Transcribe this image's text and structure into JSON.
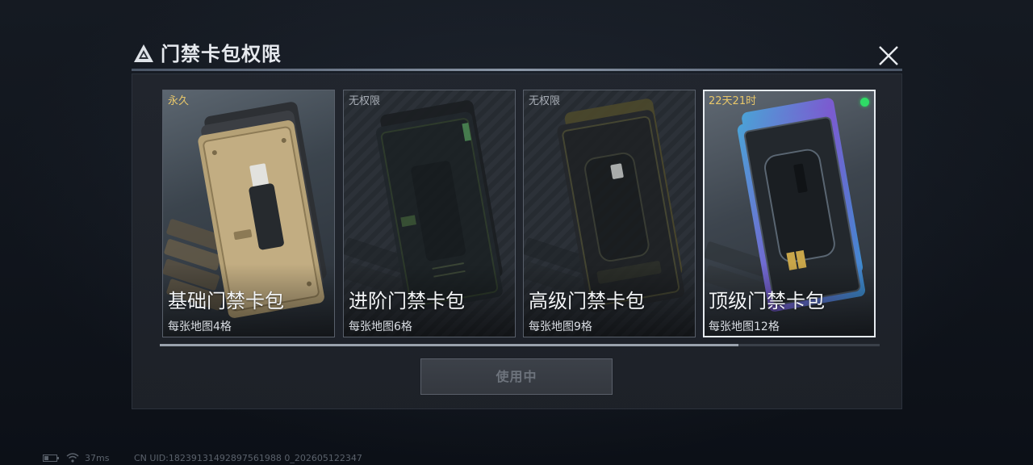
{
  "dialog": {
    "title": "门禁卡包权限",
    "use_button_label": "使用中"
  },
  "cards": [
    {
      "tag": "永久",
      "name": "基础门禁卡包",
      "desc": "每张地图4格",
      "tag_color": "#e8c76a",
      "selected": false,
      "icon": "tan-card-holder"
    },
    {
      "tag": "无权限",
      "name": "进阶门禁卡包",
      "desc": "每张地图6格",
      "tag_color": "#a8aeb6",
      "selected": false,
      "icon": "green-black-card-holder"
    },
    {
      "tag": "无权限",
      "name": "高级门禁卡包",
      "desc": "每张地图9格",
      "tag_color": "#a8aeb6",
      "selected": false,
      "icon": "olive-black-card-holder"
    },
    {
      "tag": "22天21时",
      "name": "顶级门禁卡包",
      "desc": "每张地图12格",
      "tag_color": "#e8c76a",
      "selected": true,
      "active": true,
      "icon": "iridescent-card-holder"
    }
  ],
  "scrollbar": {
    "position_fraction": 0.8
  },
  "footer": {
    "ping": "37ms",
    "uid": "CN UID:18239131492897561988 0_202605122347"
  },
  "colors": {
    "accent_active": "#2fdc66",
    "tag_gold": "#e8c76a",
    "tag_grey": "#a8aeb6"
  }
}
